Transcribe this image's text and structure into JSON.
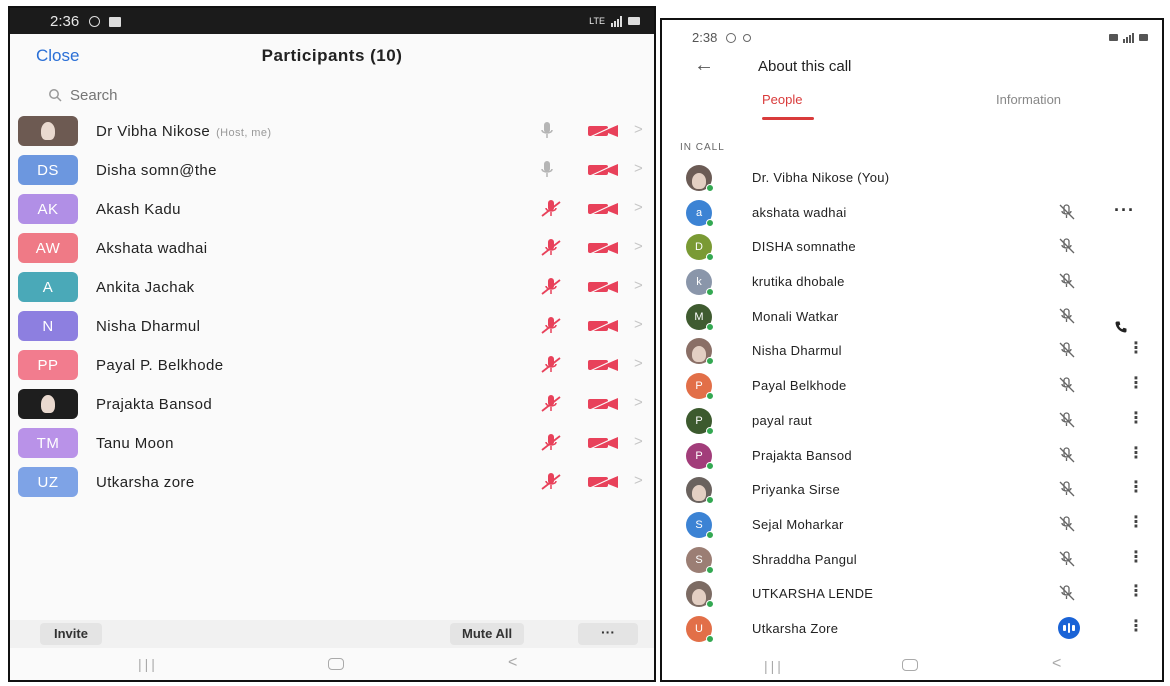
{
  "left": {
    "status": {
      "time": "2:36",
      "network": "LTE"
    },
    "header": {
      "close_label": "Close",
      "title": "Participants (10)"
    },
    "search": {
      "placeholder": "Search"
    },
    "participants": [
      {
        "name": "Dr Vibha Nikose",
        "tag": "(Host, me)",
        "initials": "",
        "photo": true,
        "color": "#6d5a52",
        "mic": "unmuted"
      },
      {
        "name": "Disha somn@the",
        "tag": "",
        "initials": "DS",
        "photo": false,
        "color": "#6c97df",
        "mic": "unmuted"
      },
      {
        "name": "Akash Kadu",
        "tag": "",
        "initials": "AK",
        "photo": false,
        "color": "#b18fe6",
        "mic": "muted"
      },
      {
        "name": "Akshata wadhai",
        "tag": "",
        "initials": "AW",
        "photo": false,
        "color": "#ef7a86",
        "mic": "muted"
      },
      {
        "name": "Ankita Jachak",
        "tag": "",
        "initials": "A",
        "photo": false,
        "color": "#4aa9b8",
        "mic": "muted"
      },
      {
        "name": "Nisha  Dharmul",
        "tag": "",
        "initials": "N",
        "photo": false,
        "color": "#8d7fe0",
        "mic": "muted"
      },
      {
        "name": "Payal P.  Belkhode",
        "tag": "",
        "initials": "PP",
        "photo": false,
        "color": "#f27c8e",
        "mic": "muted"
      },
      {
        "name": "Prajakta Bansod",
        "tag": "",
        "initials": "",
        "photo": true,
        "color": "#1e1e1e",
        "mic": "muted"
      },
      {
        "name": "Tanu Moon",
        "tag": "",
        "initials": "TM",
        "photo": false,
        "color": "#b992e8",
        "mic": "muted"
      },
      {
        "name": "Utkarsha zore",
        "tag": "",
        "initials": "UZ",
        "photo": false,
        "color": "#7ea3e6",
        "mic": "muted"
      }
    ],
    "footer": {
      "invite_label": "Invite",
      "mute_all_label": "Mute All",
      "more_label": "···"
    },
    "colors": {
      "accent": "#2a6fd6",
      "muted": "#e8415a"
    }
  },
  "right": {
    "status": {
      "time": "2:38"
    },
    "header": {
      "title": "About this call"
    },
    "tabs": [
      {
        "label": "People",
        "active": true
      },
      {
        "label": "Information",
        "active": false
      }
    ],
    "section_label": "IN CALL",
    "people": [
      {
        "name": "Dr. Vibha Nikose (You)",
        "initial": "",
        "photo": true,
        "color": "#6b5b55",
        "mic": "none"
      },
      {
        "name": "akshata wadhai",
        "initial": "a",
        "photo": false,
        "color": "#3c83d4",
        "mic": "muted"
      },
      {
        "name": "DISHA somnathe",
        "initial": "D",
        "photo": false,
        "color": "#7a9a34",
        "mic": "muted"
      },
      {
        "name": "krutika dhobale",
        "initial": "k",
        "photo": false,
        "color": "#8a96aa",
        "mic": "muted"
      },
      {
        "name": "Monali Watkar",
        "initial": "M",
        "photo": false,
        "color": "#3f5b30",
        "mic": "muted"
      },
      {
        "name": "Nisha Dharmul",
        "initial": "",
        "photo": true,
        "color": "#8a6f66",
        "mic": "muted"
      },
      {
        "name": "Payal Belkhode",
        "initial": "P",
        "photo": false,
        "color": "#e26f48",
        "mic": "muted"
      },
      {
        "name": "payal raut",
        "initial": "P",
        "photo": false,
        "color": "#3c5a2e",
        "mic": "muted"
      },
      {
        "name": "Prajakta Bansod",
        "initial": "P",
        "photo": false,
        "color": "#a23d7a",
        "mic": "muted"
      },
      {
        "name": "Priyanka Sirse",
        "initial": "",
        "photo": true,
        "color": "#6a625e",
        "mic": "muted"
      },
      {
        "name": "Sejal Moharkar",
        "initial": "S",
        "photo": false,
        "color": "#3c83d4",
        "mic": "muted"
      },
      {
        "name": "Shraddha Pangul",
        "initial": "S",
        "photo": false,
        "color": "#9b7e74",
        "mic": "muted"
      },
      {
        "name": "UTKARSHA LENDE",
        "initial": "",
        "photo": true,
        "color": "#7c6b63",
        "mic": "muted"
      },
      {
        "name": "Utkarsha Zore",
        "initial": "U",
        "photo": false,
        "color": "#e26f48",
        "mic": "speaking"
      }
    ],
    "colors": {
      "accent": "#d93b3b",
      "online": "#33a852",
      "speaking": "#1a63d6"
    }
  }
}
